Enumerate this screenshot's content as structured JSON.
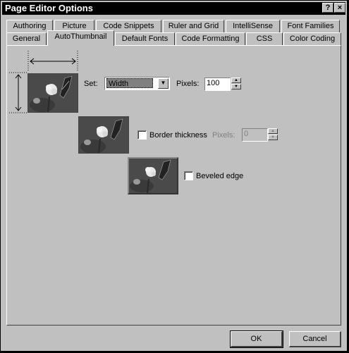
{
  "window": {
    "title": "Page Editor Options",
    "help_glyph": "?",
    "close_glyph": "×"
  },
  "tabs_back": [
    "Authoring",
    "Picture",
    "Code Snippets",
    "Ruler and Grid",
    "IntelliSense",
    "Font Families"
  ],
  "tabs_front": [
    "General",
    "AutoThumbnail",
    "Default Fonts",
    "Code Formatting",
    "CSS",
    "Color Coding"
  ],
  "active_tab": "AutoThumbnail",
  "set": {
    "label": "Set:",
    "value": "Width",
    "arrow": "▼"
  },
  "pixels1": {
    "label": "Pixels:",
    "value": "100"
  },
  "border": {
    "label": "Border thickness",
    "checked": false,
    "pixels_label": "Pixels:",
    "value": "0"
  },
  "beveled": {
    "label": "Beveled edge",
    "checked": false
  },
  "buttons": {
    "ok": "OK",
    "cancel": "Cancel"
  },
  "colors": {
    "face": "#c0c0c0",
    "titlebar": "#000000"
  }
}
